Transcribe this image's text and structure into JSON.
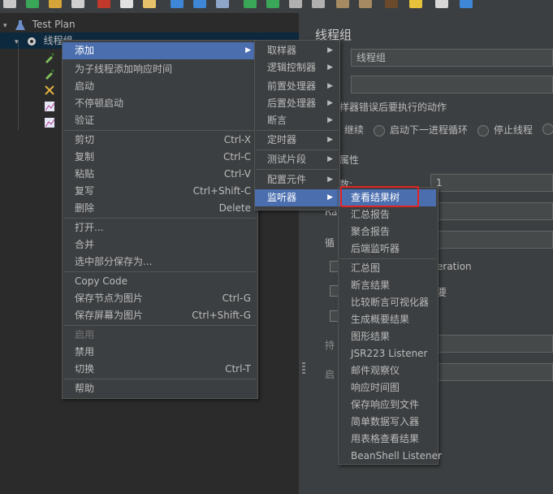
{
  "tree": {
    "root_label": "Test Plan",
    "thread_group_label": "线程组"
  },
  "right": {
    "title": "线程组",
    "name_value": "线程组",
    "error_action_label": "样器错误后要执行的动作",
    "radio_continue": "继续",
    "radio_next_loop": "启动下一进程循环",
    "radio_stop_thread": "停止线程",
    "props_label": "属性",
    "threads_label": "数:",
    "threads_value": "1",
    "rampup_label": "Ra",
    "loop_label": "循",
    "iteration_fragment": "eration",
    "delay_fragment": "要",
    "duration_label": "持",
    "startup_label": "启"
  },
  "context_menu": {
    "items": [
      {
        "label": "添加",
        "submenu": true
      },
      {
        "label": "为子线程添加响应时间"
      },
      {
        "label": "启动"
      },
      {
        "label": "不停顿启动"
      },
      {
        "label": "验证"
      },
      {
        "label": "剪切",
        "shortcut": "Ctrl-X"
      },
      {
        "label": "复制",
        "shortcut": "Ctrl-C"
      },
      {
        "label": "粘贴",
        "shortcut": "Ctrl-V"
      },
      {
        "label": "复写",
        "shortcut": "Ctrl+Shift-C"
      },
      {
        "label": "删除",
        "shortcut": "Delete"
      },
      {
        "label": "打开..."
      },
      {
        "label": "合并"
      },
      {
        "label": "选中部分保存为..."
      },
      {
        "label": "Copy Code"
      },
      {
        "label": "保存节点为图片",
        "shortcut": "Ctrl-G"
      },
      {
        "label": "保存屏幕为图片",
        "shortcut": "Ctrl+Shift-G"
      },
      {
        "label": "启用",
        "disabled": true
      },
      {
        "label": "禁用"
      },
      {
        "label": "切换",
        "shortcut": "Ctrl-T"
      },
      {
        "label": "帮助"
      }
    ]
  },
  "add_submenu": {
    "items": [
      {
        "label": "取样器"
      },
      {
        "label": "逻辑控制器"
      },
      {
        "label": "前置处理器"
      },
      {
        "label": "后置处理器"
      },
      {
        "label": "断言"
      },
      {
        "label": "定时器"
      },
      {
        "label": "测试片段"
      },
      {
        "label": "配置元件"
      },
      {
        "label": "监听器"
      }
    ]
  },
  "listener_submenu": {
    "items": [
      "查看结果树",
      "汇总报告",
      "聚合报告",
      "后端监听器",
      "汇总图",
      "断言结果",
      "比较断言可视化器",
      "生成概要结果",
      "图形结果",
      "JSR223 Listener",
      "邮件观察仪",
      "响应时间图",
      "保存响应到文件",
      "简单数据写入器",
      "用表格查看结果",
      "BeanShell Listener"
    ]
  },
  "colors": {
    "accent": "#4b6eaf",
    "highlight_box": "#e02424",
    "background": "#3c3f41",
    "tree_background": "#2b2b2b"
  }
}
